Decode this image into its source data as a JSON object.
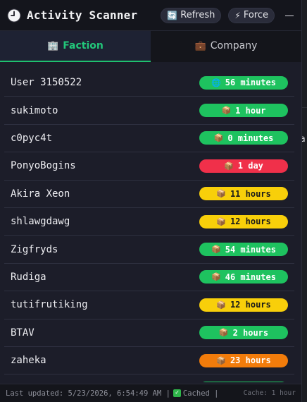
{
  "header": {
    "title": "Activity Scanner",
    "refresh_label": "Refresh",
    "force_label": "Force"
  },
  "tabs": [
    {
      "label": "Faction",
      "active": true,
      "icon": "building-icon"
    },
    {
      "label": "Company",
      "active": false,
      "icon": "briefcase-icon"
    }
  ],
  "members": [
    {
      "name": "User 3150522",
      "status": "56 minutes",
      "color": "green",
      "icon": "globe-icon"
    },
    {
      "name": "sukimoto",
      "status": "1 hour",
      "color": "green",
      "icon": "package-icon"
    },
    {
      "name": "c0pyc4t",
      "status": "0 minutes",
      "color": "green",
      "icon": "package-icon"
    },
    {
      "name": "PonyoBogins",
      "status": "1 day",
      "color": "red",
      "icon": "package-icon"
    },
    {
      "name": "Akira Xeon",
      "status": "11 hours",
      "color": "yellow",
      "icon": "package-icon"
    },
    {
      "name": "shlawgdawg",
      "status": "12 hours",
      "color": "yellow",
      "icon": "package-icon"
    },
    {
      "name": "Zigfryds",
      "status": "54 minutes",
      "color": "green",
      "icon": "package-icon"
    },
    {
      "name": "Rudiga",
      "status": "46 minutes",
      "color": "green",
      "icon": "package-icon"
    },
    {
      "name": "tutifrutiking",
      "status": "12 hours",
      "color": "yellow",
      "icon": "package-icon"
    },
    {
      "name": "BTAV",
      "status": "2 hours",
      "color": "green",
      "icon": "package-icon"
    },
    {
      "name": "zaheka",
      "status": "23 hours",
      "color": "orange",
      "icon": "package-icon"
    },
    {
      "name": "",
      "status": "",
      "color": "green",
      "icon": "package-icon"
    }
  ],
  "footer": {
    "updated": "Last updated: 5/23/2026, 6:54:49 AM |",
    "cached": "Cached |",
    "cache_hint": "Cache: 1 hour"
  },
  "colors": {
    "green": "#1ec25f",
    "red": "#f0304a",
    "yellow": "#f8cf0a",
    "orange": "#f27c0b",
    "accent": "#22c77a"
  }
}
